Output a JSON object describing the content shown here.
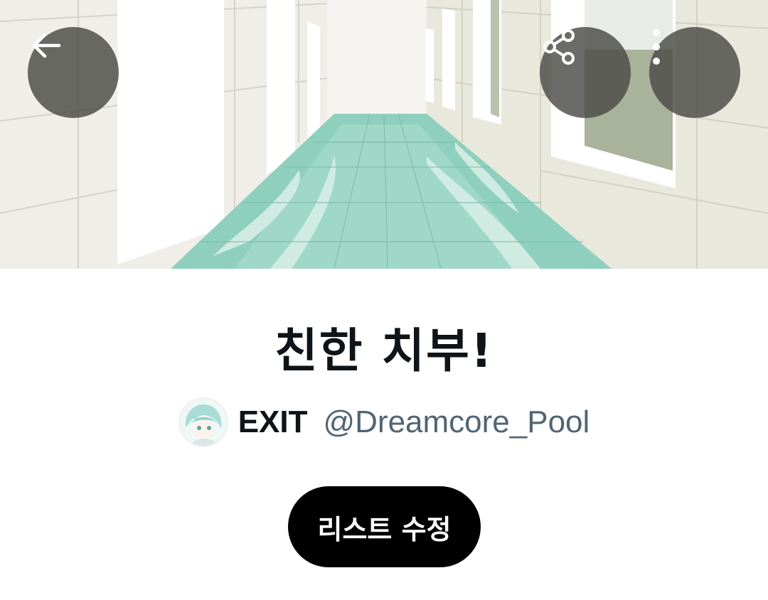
{
  "list": {
    "title": "친한 치부!",
    "owner_name": "EXIT",
    "owner_handle": "@Dreamcore_Pool"
  },
  "actions": {
    "edit_label": "리스트 수정"
  },
  "icons": {
    "back": "arrow-left-icon",
    "share": "share-icon",
    "more": "more-vertical-icon"
  },
  "colors": {
    "title": "#0f1419",
    "handle": "#536471",
    "button_bg": "#000000",
    "overlay_button": "#4b4b46"
  }
}
